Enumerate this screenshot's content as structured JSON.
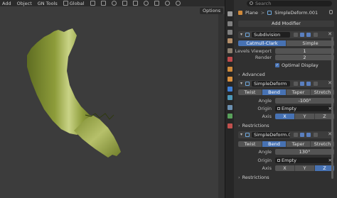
{
  "menu": {
    "add": "Add",
    "object": "Object",
    "gn_tools": "GN Tools",
    "orientation": "Global"
  },
  "viewport": {
    "options_label": "Options"
  },
  "properties": {
    "search_placeholder": "Search",
    "breadcrumb": {
      "object": "Plane",
      "separator": ">",
      "modifier": "SimpleDeform.001"
    },
    "add_modifier": "Add Modifier",
    "subdivision": {
      "name": "Subdivision",
      "type_options": [
        "Catmull-Clark",
        "Simple"
      ],
      "active_type": "Catmull-Clark",
      "levels_viewport_label": "Levels Viewport",
      "levels_viewport": "1",
      "render_label": "Render",
      "render": "2",
      "optimal_display_label": "Optimal Display",
      "optimal_display": true,
      "advanced_label": "Advanced"
    },
    "deform1": {
      "name": "SimpleDeform",
      "modes": [
        "Twist",
        "Bend",
        "Taper",
        "Stretch"
      ],
      "active_mode": "Bend",
      "angle_label": "Angle",
      "angle": "-100°",
      "origin_label": "Origin",
      "origin": "Empty",
      "axis_label": "Axis",
      "axes": [
        "X",
        "Y",
        "Z"
      ],
      "active_axis": "X",
      "restrictions_label": "Restrictions"
    },
    "deform2": {
      "name": "SimpleDeform.0...",
      "modes": [
        "Twist",
        "Bend",
        "Taper",
        "Stretch"
      ],
      "active_mode": "Bend",
      "angle_label": "Angle",
      "angle": "130°",
      "origin_label": "Origin",
      "origin": "Empty",
      "axis_label": "Axis",
      "axes": [
        "X",
        "Y",
        "Z"
      ],
      "active_axis": "Z",
      "restrictions_label": "Restrictions"
    }
  },
  "colors": {
    "accent": "#4772b3",
    "mesh": "#8a9a3c",
    "viewport_bg": "#3c3c3c"
  }
}
